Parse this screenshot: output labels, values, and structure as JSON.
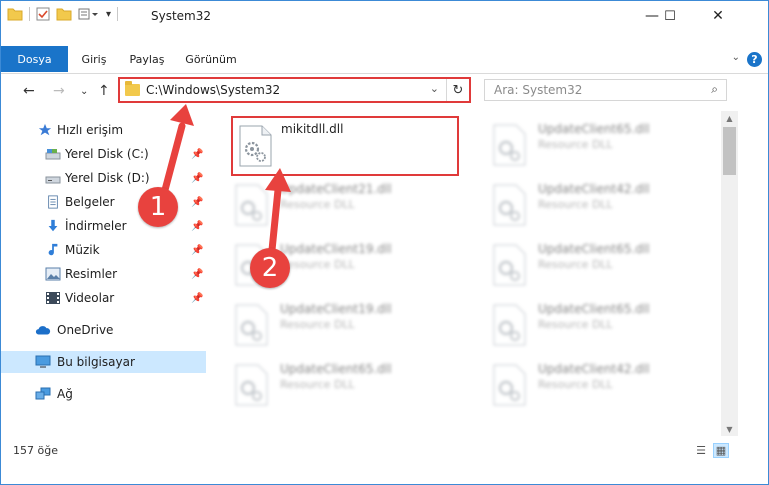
{
  "window": {
    "title": "System32",
    "minimize": "—",
    "maximize": "☐",
    "close": "✕"
  },
  "ribbon": {
    "tabs": [
      "Dosya",
      "Giriş",
      "Paylaş",
      "Görünüm"
    ],
    "help": "?"
  },
  "nav": {
    "address": "C:\\Windows\\System32",
    "search_placeholder": "Ara: System32"
  },
  "sidebar": {
    "items": [
      {
        "label": "Hızlı erişim",
        "icon": "star-icon"
      },
      {
        "label": "Yerel Disk (C:)",
        "icon": "drive-icon",
        "pinned": true
      },
      {
        "label": "Yerel Disk (D:)",
        "icon": "drive-icon",
        "pinned": true
      },
      {
        "label": "Belgeler",
        "icon": "documents-icon",
        "pinned": true
      },
      {
        "label": "İndirmeler",
        "icon": "download-icon",
        "pinned": true
      },
      {
        "label": "Müzik",
        "icon": "music-icon",
        "pinned": true
      },
      {
        "label": "Resimler",
        "icon": "pictures-icon",
        "pinned": true
      },
      {
        "label": "Videolar",
        "icon": "videos-icon",
        "pinned": true
      },
      {
        "label": "OneDrive",
        "icon": "cloud-icon"
      },
      {
        "label": "Bu bilgisayar",
        "icon": "computer-icon",
        "selected": true
      },
      {
        "label": "Ağ",
        "icon": "network-icon"
      }
    ]
  },
  "files": [
    {
      "name": "mikitdll.dll",
      "desc": ""
    },
    {
      "name": "UpdateClient65.dll",
      "desc": "Resource DLL"
    },
    {
      "name": "UpdateClient21.dll",
      "desc": "Resource DLL"
    },
    {
      "name": "UpdateClient42.dll",
      "desc": "Resource DLL"
    },
    {
      "name": "UpdateClient19.dll",
      "desc": "Resource DLL"
    },
    {
      "name": "UpdateClient65.dll",
      "desc": "Resource DLL"
    },
    {
      "name": "UpdateClient19.dll",
      "desc": "Resource DLL"
    },
    {
      "name": "UpdateClient65.dll",
      "desc": "Resource DLL"
    },
    {
      "name": "UpdateClient65.dll",
      "desc": "Resource DLL"
    },
    {
      "name": "UpdateClient42.dll",
      "desc": "Resource DLL"
    }
  ],
  "status": {
    "count": "157 öğe"
  },
  "annotations": {
    "step1": "1",
    "step2": "2",
    "color": "#e8423e"
  }
}
